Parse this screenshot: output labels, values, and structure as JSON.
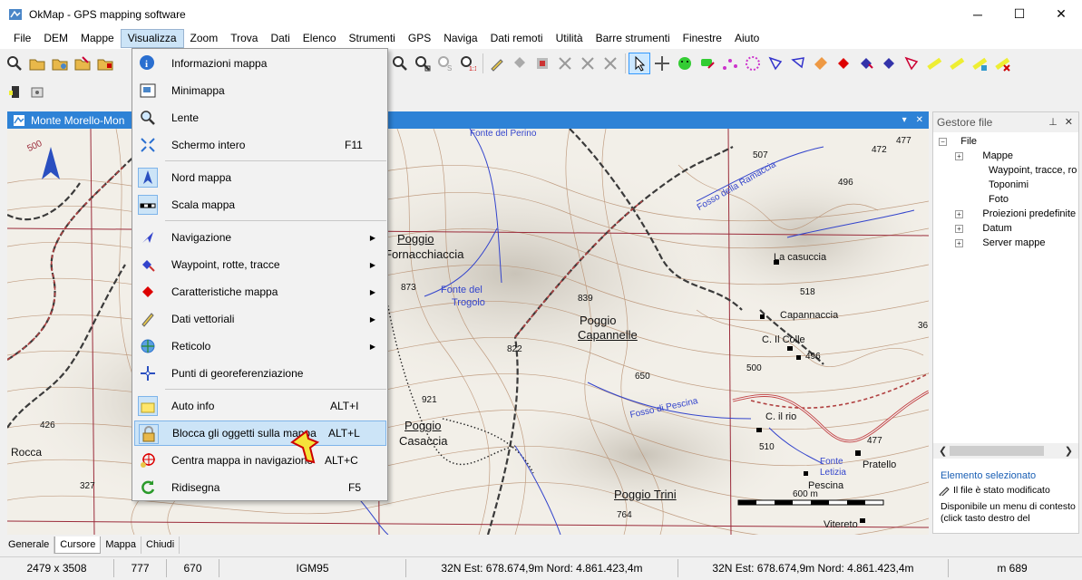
{
  "window": {
    "title": "OkMap - GPS mapping software",
    "minimize": "─",
    "maximize": "☐",
    "close": "✕"
  },
  "menubar": [
    "File",
    "DEM",
    "Mappe",
    "Visualizza",
    "Zoom",
    "Trova",
    "Dati",
    "Elenco",
    "Strumenti",
    "GPS",
    "Naviga",
    "Dati remoti",
    "Utilità",
    "Barre strumenti",
    "Finestre",
    "Aiuto"
  ],
  "map_window": {
    "title": "Monte Morello-Mon",
    "pin": "▾",
    "close": "✕"
  },
  "dropdown": [
    {
      "label": "Informazioni mappa",
      "shortcut": "",
      "submenu": false
    },
    {
      "label": "Minimappa",
      "shortcut": "",
      "submenu": false
    },
    {
      "label": "Lente",
      "shortcut": "",
      "submenu": false
    },
    {
      "label": "Schermo intero",
      "shortcut": "F11",
      "submenu": false
    },
    {
      "label": "Nord mappa",
      "shortcut": "",
      "submenu": false
    },
    {
      "label": "Scala mappa",
      "shortcut": "",
      "submenu": false
    },
    {
      "label": "Navigazione",
      "shortcut": "",
      "submenu": true
    },
    {
      "label": "Waypoint, rotte, tracce",
      "shortcut": "",
      "submenu": true
    },
    {
      "label": "Caratteristiche mappa",
      "shortcut": "",
      "submenu": true
    },
    {
      "label": "Dati vettoriali",
      "shortcut": "",
      "submenu": true
    },
    {
      "label": "Reticolo",
      "shortcut": "",
      "submenu": true
    },
    {
      "label": "Punti di georeferenziazione",
      "shortcut": "",
      "submenu": false
    },
    {
      "label": "Auto info",
      "shortcut": "ALT+I",
      "submenu": false
    },
    {
      "label": "Blocca gli oggetti sulla mappa",
      "shortcut": "ALT+L",
      "submenu": false
    },
    {
      "label": "Centra mappa in navigazione",
      "shortcut": "ALT+C",
      "submenu": false
    },
    {
      "label": "Ridisegna",
      "shortcut": "F5",
      "submenu": false
    }
  ],
  "file_panel": {
    "title": "Gestore file",
    "root": "File",
    "items": [
      "Mappe",
      "Waypoint, tracce, ro",
      "Toponimi",
      "Foto",
      "Proiezioni predefinite",
      "Datum",
      "Server mappe"
    ],
    "selected_title": "Elemento selezionato",
    "modified": "Il file è stato modificato",
    "description": "Disponibile un menu di contesto (click tasto destro del"
  },
  "map_labels": [
    "Poggio",
    "Fornacchiaccia",
    "Fonte del",
    "Trogolo",
    "Poggio",
    "Capannelle",
    "Poggio",
    "Casaccia",
    "Poggio Trini",
    "La casuccia",
    "Capannaccia",
    "C. Il Colle",
    "C. il rio",
    "Pescina",
    "Pratello",
    "Vitereto",
    "Rocca",
    "Fonte del Perino",
    "Fosso della Ramaccia",
    "Fosso di Pescina",
    "Fonte",
    "Letizia",
    "873",
    "839",
    "822",
    "921",
    "650",
    "764",
    "507",
    "496",
    "518",
    "496",
    "500",
    "510",
    "477",
    "472",
    "477",
    "426",
    "327",
    "500",
    "36",
    "600 m"
  ],
  "bottom_tabs": [
    "Generale",
    "Cursore",
    "Mappa",
    "Chiudi"
  ],
  "status": {
    "size": "2479 x 3508",
    "px": "777",
    "py": "670",
    "datum": "IGM95",
    "coord1": "32N  Est: 678.674,9m  Nord: 4.861.423,4m",
    "coord2": "32N  Est: 678.674,9m  Nord: 4.861.423,4m",
    "alt": "m 689"
  }
}
